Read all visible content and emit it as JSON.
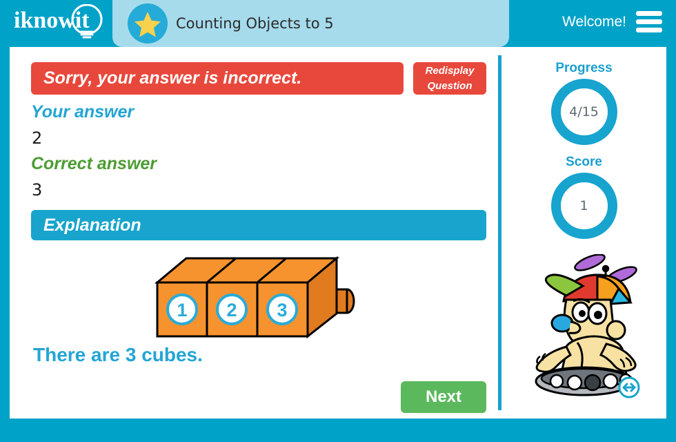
{
  "header": {
    "logo_text": "iknowit",
    "title": "Counting Objects to 5",
    "welcome": "Welcome!",
    "menu_icon": "hamburger-menu-icon",
    "star_icon": "star-icon",
    "tab_bg": "#a6dbec",
    "bar_bg": "#00a2c8"
  },
  "main": {
    "result_message": "Sorry, your answer is incorrect.",
    "result_color": "#e8483c",
    "redisplay_line1": "Redisplay",
    "redisplay_line2": "Question",
    "your_answer_label": "Your answer",
    "your_answer_value": "2",
    "your_answer_color": "#23a5d4",
    "correct_answer_label": "Correct answer",
    "correct_answer_value": "3",
    "correct_answer_color": "#4d9c33",
    "explanation_label": "Explanation",
    "explanation_color": "#18a4cc",
    "explanation_text": "There are 3 cubes.",
    "cube_labels": [
      "1",
      "2",
      "3"
    ],
    "cube_color": "#f6932e",
    "next_label": "Next",
    "next_color": "#5cb85c"
  },
  "sidebar": {
    "progress_label": "Progress",
    "progress_value": "4/15",
    "score_label": "Score",
    "score_value": "1",
    "accent_color": "#17a4ce",
    "mascot_name": "robot-mascot",
    "resize_icon": "resize-horizontal-icon"
  }
}
